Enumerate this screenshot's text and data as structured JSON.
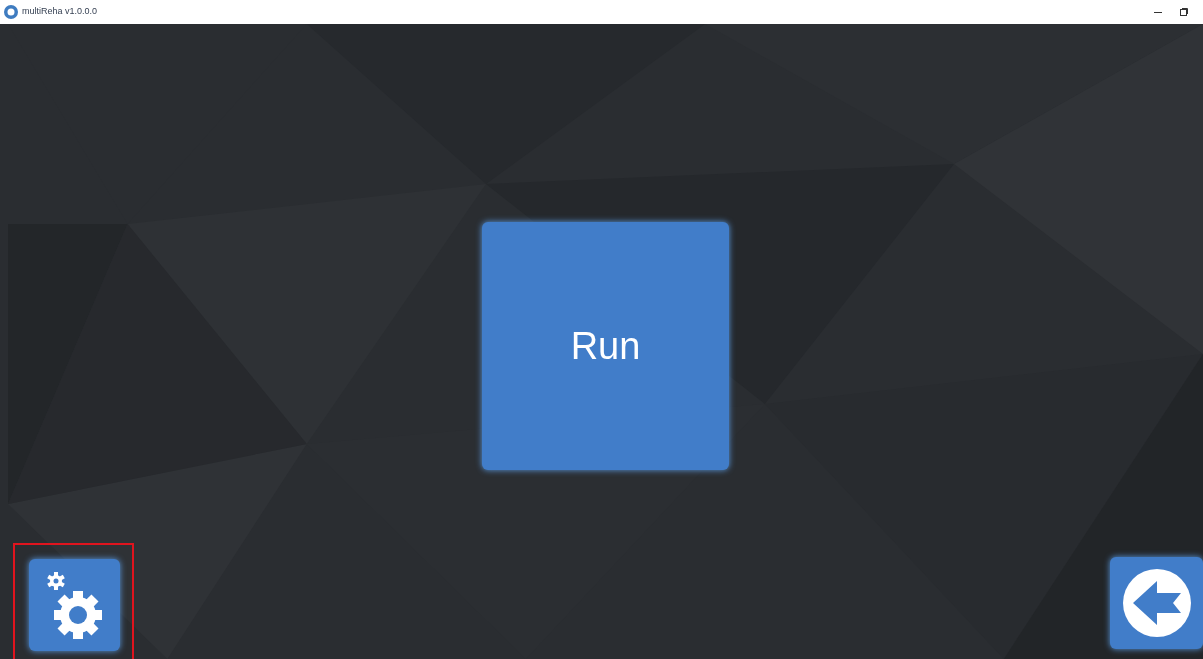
{
  "window": {
    "title": "multiReha v1.0.0.0"
  },
  "run_button": {
    "label": "Run"
  },
  "settings_button": {
    "highlighted": true
  }
}
